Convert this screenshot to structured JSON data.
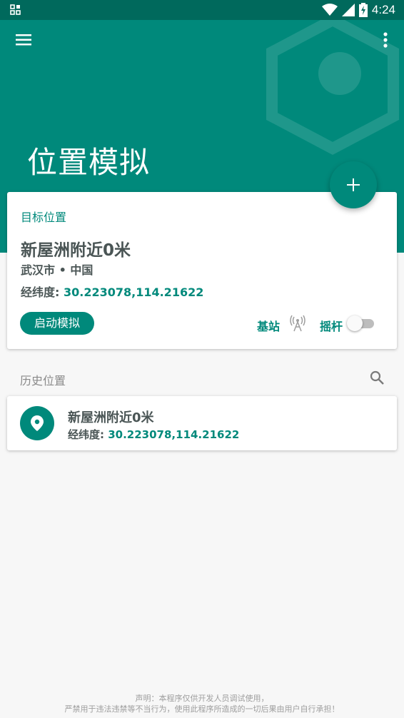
{
  "status_bar": {
    "time": "4:24"
  },
  "header": {
    "title": "位置模拟"
  },
  "target_card": {
    "label": "目标位置",
    "place_name": "新屋洲附近0米",
    "city": "武汉市 • 中国",
    "coord_label": "经纬度:",
    "coord_value": "30.223078,114.21622",
    "start_button": "启动模拟",
    "station_label": "基站",
    "joystick_label": "摇杆",
    "joystick_enabled": false
  },
  "history": {
    "title": "历史位置",
    "items": [
      {
        "name": "新屋洲附近0米",
        "coord_label": "经纬度:",
        "coord_value": "30.223078,114.21622"
      }
    ]
  },
  "disclaimer": {
    "line1": "声明：本程序仅供开发人员调试使用，",
    "line2": "严禁用于违法违禁等不当行为，使用此程序所造成的一切后果由用户自行承担！"
  },
  "colors": {
    "primary": "#00897b",
    "primary_dark": "#00695c"
  }
}
